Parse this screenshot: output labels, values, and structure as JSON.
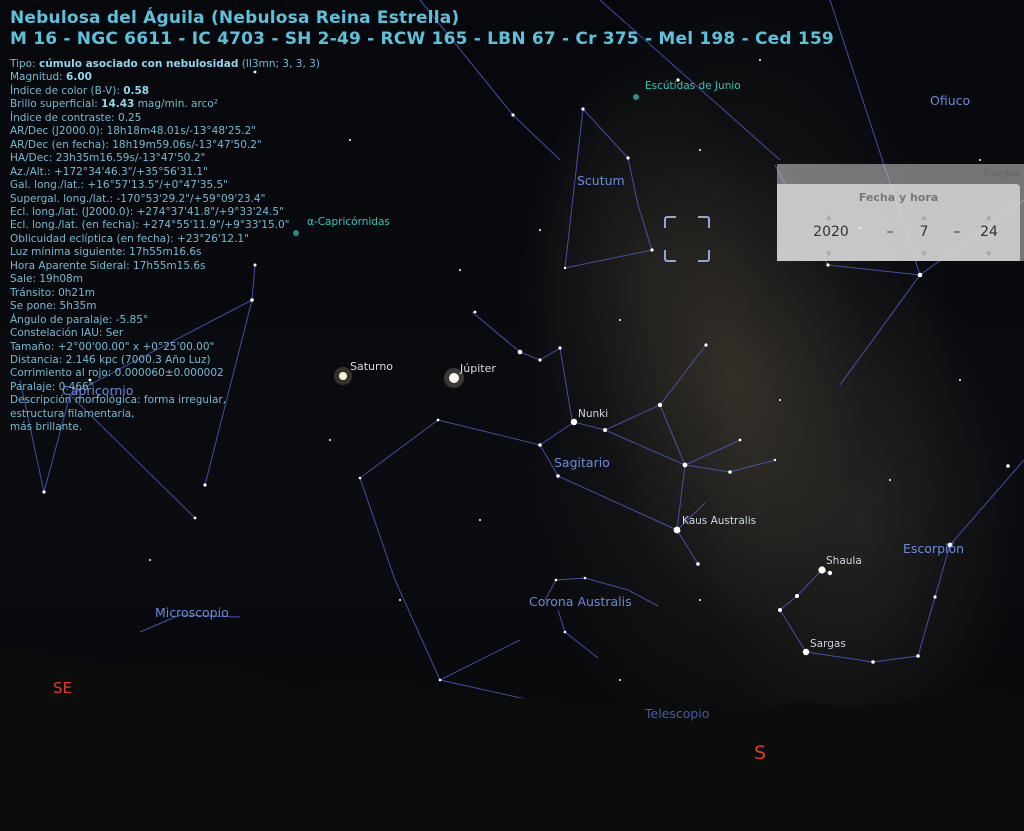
{
  "object": {
    "title": "Nebulosa del Águila (Nebulosa Reina Estrella)",
    "ids": "M 16 - NGC 6611 - IC 4703 - SH 2-49 - RCW 165 - LBN 67 - Cr 375 - Mel 198 - Ced 159",
    "lines": [
      {
        "label": "Tipo: ",
        "value": "cúmulo asociado con nebulosidad",
        "suffix": " (II3mn; 3, 3, 3)"
      },
      {
        "label": "Magnitud: ",
        "value": "6.00",
        "suffix": ""
      },
      {
        "label": "Índice de color (B-V): ",
        "value": "0.58",
        "suffix": ""
      },
      {
        "label": "Brillo superficial: ",
        "value": "14.43",
        "suffix": " mag/min. arco²"
      },
      {
        "label": "Índice de contraste: 0.25",
        "value": "",
        "suffix": ""
      },
      {
        "label": "AR/Dec (J2000.0): 18h18m48.01s/-13°48'25.2\"",
        "value": "",
        "suffix": ""
      },
      {
        "label": "AR/Dec (en fecha): 18h19m59.06s/-13°47'50.2\"",
        "value": "",
        "suffix": ""
      },
      {
        "label": "HA/Dec: 23h35m16.59s/-13°47'50.2\"",
        "value": "",
        "suffix": ""
      },
      {
        "label": "Az./Alt.: +172°34'46.3\"/+35°56'31.1\"",
        "value": "",
        "suffix": ""
      },
      {
        "label": "Gal. long./lat.: +16°57'13.5\"/+0°47'35.5\"",
        "value": "",
        "suffix": ""
      },
      {
        "label": "Supergal. long./lat.: -170°53'29.2\"/+59°09'23.4\"",
        "value": "",
        "suffix": ""
      },
      {
        "label": "Ecl. long./lat. (J2000.0): +274°37'41.8\"/+9°33'24.5\"",
        "value": "",
        "suffix": ""
      },
      {
        "label": "Ecl. long./lat. (en fecha): +274°55'11.9\"/+9°33'15.0\"",
        "value": "",
        "suffix": ""
      },
      {
        "label": "Oblicuidad eclíptica (en fecha): +23°26'12.1\"",
        "value": "",
        "suffix": ""
      },
      {
        "label": "Luz mínima siguiente: 17h55m16.6s",
        "value": "",
        "suffix": ""
      },
      {
        "label": "Hora Aparente Sideral: 17h55m15.6s",
        "value": "",
        "suffix": ""
      },
      {
        "label": "Sale: 19h08m",
        "value": "",
        "suffix": ""
      },
      {
        "label": "Tránsito: 0h21m",
        "value": "",
        "suffix": ""
      },
      {
        "label": "Se pone: 5h35m",
        "value": "",
        "suffix": ""
      },
      {
        "label": "Ángulo de paralaje: -5.85°",
        "value": "",
        "suffix": ""
      },
      {
        "label": "Constelación IAU: Ser",
        "value": "",
        "suffix": ""
      },
      {
        "label": "Tamaño: +2°00'00.00\" x +0°25'00.00\"",
        "value": "",
        "suffix": ""
      },
      {
        "label": "Distancia: 2.146 kpc (7000.3 Año Luz)",
        "value": "",
        "suffix": ""
      },
      {
        "label": "Corrimiento al rojo: 0.000060±0.000002",
        "value": "",
        "suffix": ""
      },
      {
        "label": "Paralaje: 0.466\"",
        "value": "",
        "suffix": ""
      },
      {
        "label": "Descripción morfológica: forma irregular,",
        "value": "",
        "suffix": ""
      },
      {
        "label": "estructura filamentaria,",
        "value": "",
        "suffix": ""
      },
      {
        "label": "más brillante.",
        "value": "",
        "suffix": ""
      }
    ]
  },
  "labels": {
    "escutidas": "Escútidas de Junio",
    "ofiuco": "Ofiuco",
    "scutum": "Scutum",
    "capricornidas": "α-Capricórnidas",
    "saturno": "Saturno",
    "jupiter": "Júpiter",
    "capricornio": "Capricornio",
    "nunki": "Nunki",
    "sagitario": "Sagitario",
    "kaus": "Kaus Australis",
    "shaula": "Shaula",
    "escorpion": "Escorpión",
    "corona": "Corona Australis",
    "sargas": "Sargas",
    "microscopio": "Microscopio",
    "telescopio": "Telescopio",
    "se": "SE",
    "s": "S"
  },
  "date_panel": {
    "window_title": "Fecha",
    "inner_title": "Fecha y hora",
    "year": "2020",
    "month": "7",
    "day": "24",
    "sep1": "–",
    "sep2": "–"
  },
  "colors": {
    "info_text": "#5ec1dc",
    "constellation_lines": "#4a57b8",
    "cardinal": "#e03a24",
    "meteor_label": "#2fc8b8"
  }
}
